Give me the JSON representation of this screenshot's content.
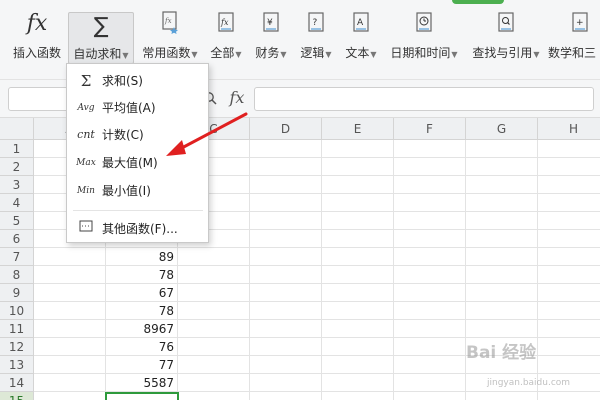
{
  "ribbon": {
    "buttons": [
      {
        "id": "insert",
        "label": "插入函数",
        "icon": "fx-icon"
      },
      {
        "id": "autosum",
        "label": "自动求和",
        "icon": "sigma-icon",
        "active": true
      },
      {
        "id": "common",
        "label": "常用函数",
        "icon": "star-fx-icon"
      },
      {
        "id": "all",
        "label": "全部",
        "icon": "fx-book-icon"
      },
      {
        "id": "finance",
        "label": "财务",
        "icon": "yen-book-icon"
      },
      {
        "id": "logic",
        "label": "逻辑",
        "icon": "question-book-icon"
      },
      {
        "id": "text",
        "label": "文本",
        "icon": "a-book-icon"
      },
      {
        "id": "datetime",
        "label": "日期和时间",
        "icon": "clock-book-icon"
      },
      {
        "id": "lookup",
        "label": "查找与引用",
        "icon": "search-book-icon"
      },
      {
        "id": "math",
        "label": "数学和三",
        "icon": "plus-book-icon"
      }
    ]
  },
  "formula_bar": {
    "fx_symbol": "fx",
    "name_box_value": ""
  },
  "columns": [
    "A",
    "B",
    "C",
    "D",
    "E",
    "F",
    "G",
    "H"
  ],
  "rows": [
    "1",
    "2",
    "3",
    "4",
    "5",
    "6",
    "7",
    "8",
    "9",
    "10",
    "11",
    "12",
    "13",
    "14",
    "15"
  ],
  "cells_b": [
    {
      "row": 7,
      "value": "89"
    },
    {
      "row": 8,
      "value": "78"
    },
    {
      "row": 9,
      "value": "67"
    },
    {
      "row": 10,
      "value": "78"
    },
    {
      "row": 11,
      "value": "8967"
    },
    {
      "row": 12,
      "value": "76"
    },
    {
      "row": 13,
      "value": "77"
    },
    {
      "row": 14,
      "value": "5587"
    }
  ],
  "menu": {
    "items": [
      {
        "icon": "sigma-icon",
        "icon_text": "Σ",
        "label": "求和(S)"
      },
      {
        "icon": "avg-icon",
        "icon_text": "Avg",
        "label": "平均值(A)"
      },
      {
        "icon": "cnt-icon",
        "icon_text": "cnt",
        "label": "计数(C)"
      },
      {
        "icon": "max-icon",
        "icon_text": "Max",
        "label": "最大值(M)"
      },
      {
        "icon": "min-icon",
        "icon_text": "Min",
        "label": "最小值(I)"
      },
      {
        "icon": "other-functions-icon",
        "icon_text": "",
        "label": "其他函数(F)..."
      }
    ]
  },
  "colors": {
    "accent_green": "#2e9a3c",
    "arrow_red": "#e02020"
  },
  "watermark": {
    "main": "Bai 经验",
    "sub": "jingyan.baidu.com"
  }
}
